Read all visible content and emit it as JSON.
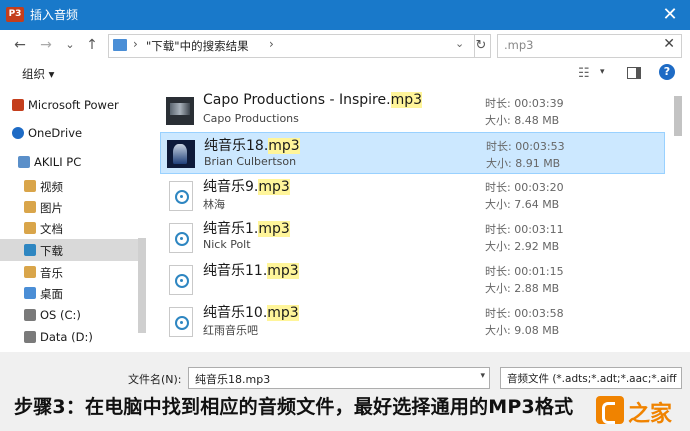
{
  "window": {
    "title": "插入音频",
    "app_icon": "P3",
    "close_glyph": "✕"
  },
  "nav": {
    "back": "←",
    "forward": "→",
    "recent": "⌄",
    "up": "↑",
    "breadcrumb_sep": "›",
    "path": "\"下载\"中的搜索结果",
    "dropdown": "⌄",
    "refresh": "↻"
  },
  "search": {
    "value": ".mp3",
    "clear": "✕"
  },
  "toolbar": {
    "organize": "组织 ▾",
    "view_icon": "☷",
    "view_drop": "▾",
    "help": "?"
  },
  "sidebar": {
    "items": [
      {
        "label": "Microsoft Power",
        "icon": "powerpoint-icon",
        "color": "#c43e1c"
      },
      {
        "label": "OneDrive",
        "icon": "cloud-icon",
        "color": "#1e6bc5"
      },
      {
        "label": "AKILI PC",
        "icon": "computer-icon",
        "color": "#5a8fc9"
      },
      {
        "label": "视频",
        "icon": "video-folder-icon",
        "color": "#d9a54a"
      },
      {
        "label": "图片",
        "icon": "pictures-folder-icon",
        "color": "#d9a54a"
      },
      {
        "label": "文档",
        "icon": "documents-folder-icon",
        "color": "#d9a54a"
      },
      {
        "label": "下载",
        "icon": "downloads-folder-icon",
        "color": "#2e86c1",
        "selected": true
      },
      {
        "label": "音乐",
        "icon": "music-folder-icon",
        "color": "#d9a54a"
      },
      {
        "label": "桌面",
        "icon": "desktop-folder-icon",
        "color": "#4a8ed6"
      },
      {
        "label": "OS (C:)",
        "icon": "drive-icon",
        "color": "#7a7a7a"
      },
      {
        "label": "Data (D:)",
        "icon": "drive-icon",
        "color": "#7a7a7a"
      }
    ]
  },
  "files": [
    {
      "name": "Capo Productions - Inspire.",
      "ext": "mp3",
      "sub": "Capo Productions",
      "dur_label": "时长: 00:03:39",
      "size_label": "大小: 8.48 MB",
      "thumb": "album"
    },
    {
      "name": "纯音乐18.",
      "ext": "mp3",
      "sub": "Brian Culbertson",
      "dur_label": "时长: 00:03:53",
      "size_label": "大小: 8.91 MB",
      "thumb": "album2",
      "selected": true
    },
    {
      "name": "纯音乐9.",
      "ext": "mp3",
      "sub": "林海",
      "dur_label": "时长: 00:03:20",
      "size_label": "大小: 7.64 MB",
      "thumb": "doc"
    },
    {
      "name": "纯音乐1.",
      "ext": "mp3",
      "sub": "Nick Polt",
      "dur_label": "时长: 00:03:11",
      "size_label": "大小: 2.92 MB",
      "thumb": "doc"
    },
    {
      "name": "纯音乐11.",
      "ext": "mp3",
      "sub": "",
      "dur_label": "时长: 00:01:15",
      "size_label": "大小: 2.88 MB",
      "thumb": "doc"
    },
    {
      "name": "纯音乐10.",
      "ext": "mp3",
      "sub": "红雨音乐吧",
      "dur_label": "时长: 00:03:58",
      "size_label": "大小: 9.08 MB",
      "thumb": "doc"
    }
  ],
  "footer": {
    "filename_label": "文件名(N):",
    "filename_value": "纯音乐18.mp3",
    "filename_drop": "▾",
    "filetype_value": "音频文件 (*.adts;*.adt;*.aac;*.aiff"
  },
  "caption": "步骤3：在电脑中找到相应的音频文件，最好选择通用的MP3格式",
  "watermark": "之家"
}
